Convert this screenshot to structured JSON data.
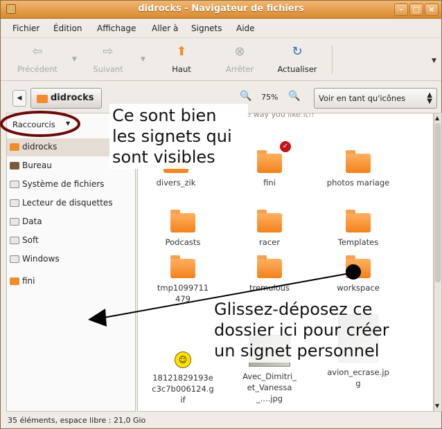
{
  "window": {
    "title": "didrocks - Navigateur de fichiers"
  },
  "menu": [
    "Fichier",
    "Édition",
    "Affichage",
    "Aller à",
    "Signets",
    "Aide"
  ],
  "toolbar": {
    "back": "Précédent",
    "forward": "Suivant",
    "up": "Haut",
    "stop": "Arrêter",
    "reload": "Actualiser"
  },
  "location": {
    "crumb": "didrocks",
    "zoom": "75%",
    "view_mode": "Voir en tant qu'icônes"
  },
  "sidebar": {
    "header": "Raccourcis",
    "items": [
      {
        "label": "didrocks",
        "icon": "home-folder-icon"
      },
      {
        "label": "Bureau",
        "icon": "desktop-icon"
      },
      {
        "label": "Système de fichiers",
        "icon": "drive-icon"
      },
      {
        "label": "Lecteur de disquettes",
        "icon": "drive-icon"
      },
      {
        "label": "Data",
        "icon": "drive-icon"
      },
      {
        "label": "Soft",
        "icon": "drive-icon"
      },
      {
        "label": "Windows",
        "icon": "drive-icon"
      },
      {
        "label": "fini",
        "icon": "folder-icon"
      }
    ]
  },
  "files": {
    "partial_top": "the way you like it!!",
    "items": [
      {
        "label": "divers_zik",
        "kind": "folder"
      },
      {
        "label": "fini",
        "kind": "folder"
      },
      {
        "label": "photos mariage",
        "kind": "folder"
      },
      {
        "label": "Podcasts",
        "kind": "folder"
      },
      {
        "label": "racer",
        "kind": "folder"
      },
      {
        "label": "Templates",
        "kind": "folder"
      },
      {
        "label": "tmp1099711479",
        "kind": "folder"
      },
      {
        "label": "tremulous",
        "kind": "folder"
      },
      {
        "label": "workspace",
        "kind": "folder"
      },
      {
        "label": "18121829193ec3c7b006124.gif",
        "kind": "gif"
      },
      {
        "label": "Avec_Dimitri_et_Vanessa_....jpg",
        "kind": "image"
      },
      {
        "label": "avion_ecrase.jpg",
        "kind": "image"
      }
    ]
  },
  "status": "35 éléments, espace libre : 21,0 Gio",
  "annotations": {
    "callout1": [
      "Ce sont bien",
      "les signets qui",
      "sont visibles"
    ],
    "callout2": [
      "Glissez-déposez ce",
      "dossier ici pour créer",
      "un signet personnel"
    ]
  },
  "colors": {
    "title_bar": "#e09a48",
    "folder": "#f28c2a",
    "ellipse": "#6b0a0a"
  }
}
